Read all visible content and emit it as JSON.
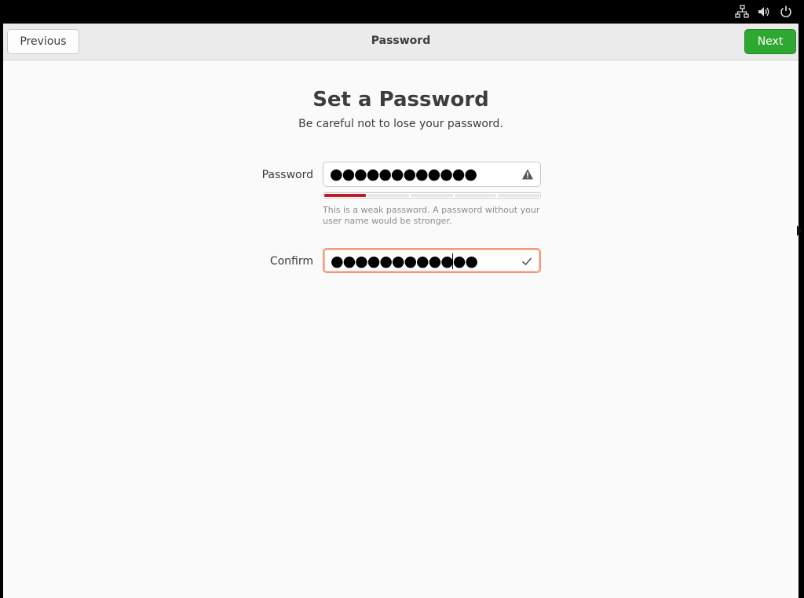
{
  "system": {
    "icons": [
      "network-icon",
      "volume-icon",
      "power-icon"
    ]
  },
  "header": {
    "previous_label": "Previous",
    "title": "Password",
    "next_label": "Next"
  },
  "page": {
    "heading": "Set a Password",
    "subheading": "Be careful not to lose your password."
  },
  "password": {
    "label": "Password",
    "value": "●●●●●●●●●●●●",
    "status_icon": "warning-icon",
    "strength_fraction": 0.2,
    "hint": "This is a weak password. A password without your user name would be stronger."
  },
  "confirm": {
    "label": "Confirm",
    "value": "●●●●●●●●●●●●",
    "status_icon": "check-icon"
  },
  "colors": {
    "accent_green": "#2fa831",
    "strength_weak": "#c01c28",
    "focus_orange": "#f29a79"
  }
}
